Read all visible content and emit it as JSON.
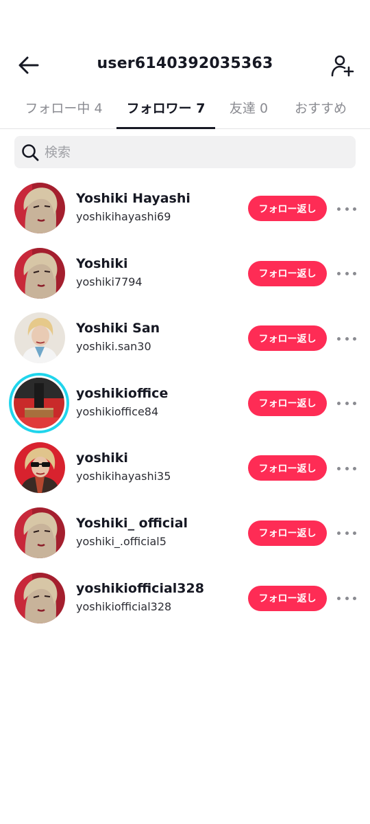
{
  "header": {
    "title": "user6140392035363",
    "back_icon": "arrow-left-icon",
    "add_user_icon": "person-plus-icon"
  },
  "tabs": [
    {
      "label": "フォロー中 4",
      "active": false
    },
    {
      "label": "フォロワー 7",
      "active": true
    },
    {
      "label": "友達 0",
      "active": false
    },
    {
      "label": "おすすめ",
      "active": false
    }
  ],
  "search": {
    "placeholder": "検索",
    "icon": "search-icon"
  },
  "colors": {
    "accent": "#fe2c55",
    "text": "#161823",
    "muted": "#8a8b91",
    "story_ring": "#20d5ec"
  },
  "followers": [
    {
      "display_name": "Yoshiki Hayashi",
      "username": "yoshikihayashi69",
      "button": "フォロー返し",
      "avatar": "photo-red"
    },
    {
      "display_name": "Yoshiki",
      "username": "yoshiki7794",
      "button": "フォロー返し",
      "avatar": "photo-red"
    },
    {
      "display_name": "Yoshiki San",
      "username": "yoshiki.san30",
      "button": "フォロー返し",
      "avatar": "photo-light"
    },
    {
      "display_name": "yoshikioffice",
      "username": "yoshikioffice84",
      "button": "フォロー返し",
      "avatar": "photo-stage",
      "story_ring": true
    },
    {
      "display_name": "yoshiki",
      "username": "yoshikihayashi35",
      "button": "フォロー返し",
      "avatar": "photo-sunglasses"
    },
    {
      "display_name": "Yoshiki_ official",
      "username": "yoshiki_.official5",
      "button": "フォロー返し",
      "avatar": "photo-red"
    },
    {
      "display_name": "yoshikiofficial328",
      "username": "yoshikiofficial328",
      "button": "フォロー返し",
      "avatar": "photo-red"
    }
  ]
}
